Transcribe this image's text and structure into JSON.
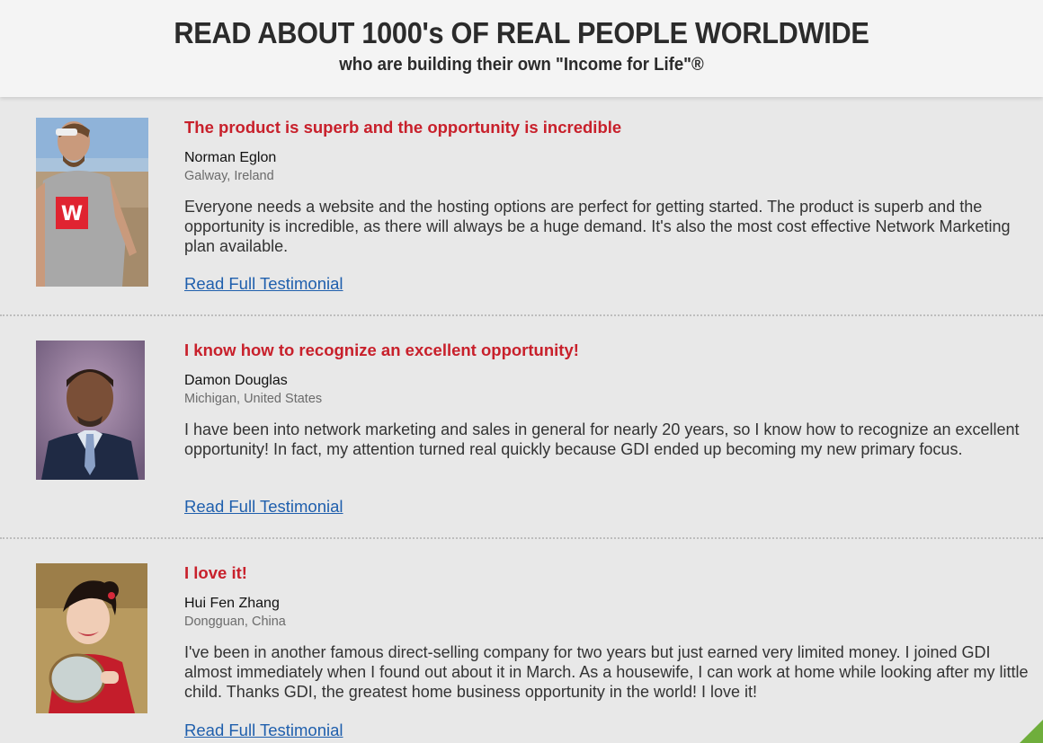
{
  "header": {
    "title": "READ ABOUT 1000's OF REAL PEOPLE WORLDWIDE",
    "subtitle": "who are building their own \"Income for Life\"®"
  },
  "testimonials": [
    {
      "headline": "The product is superb and the opportunity is incredible",
      "name": "Norman Eglon",
      "location": "Galway, Ireland",
      "body": "Everyone needs a website and the hosting options are perfect for getting started. The product is superb and the opportunity is incredible, as there will always be a huge demand. It's also the most cost effective Network Marketing plan available.",
      "link": "Read Full Testimonial"
    },
    {
      "headline": "I know how to recognize an excellent opportunity!",
      "name": "Damon Douglas",
      "location": "Michigan, United States",
      "body": "I have been into network marketing and sales in general for nearly 20 years, so I know how to recognize an excellent opportunity! In fact, my attention turned real quickly because GDI ended up becoming my new primary focus.",
      "link": "Read Full Testimonial"
    },
    {
      "headline": "I love it!",
      "name": "Hui Fen Zhang",
      "location": "Dongguan, China",
      "body": "I've been in another famous direct-selling company for two years but just earned very limited money. I joined GDI almost immediately when I found out about it in March. As a housewife, I can work at home while looking after my little child. Thanks GDI, the greatest home business opportunity in the world! I love it!",
      "link": "Read Full Testimonial"
    }
  ],
  "colors": {
    "headline": "#c8202b",
    "link": "#1f5fad",
    "accent_corner": "#6fae3c"
  }
}
